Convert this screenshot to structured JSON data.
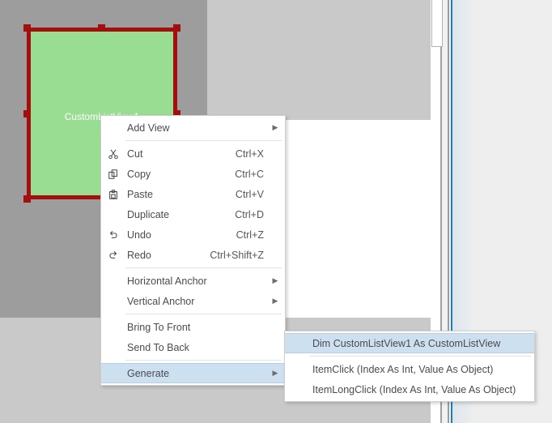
{
  "canvas": {
    "selected_view": {
      "label": "CustomListView1",
      "fill_color": "#99dd92",
      "border_color": "#a50e0e",
      "handle_color": "#a50e0e"
    },
    "backdrop_dark": "#9d9d9d",
    "backdrop_light": "#c9c9c9"
  },
  "context_menu": {
    "highlight_color": "#cde0f0",
    "items": [
      {
        "label": "Add View",
        "icon": "",
        "shortcut": "",
        "arrow": true,
        "selected": false,
        "separator_after": true
      },
      {
        "label": "Cut",
        "icon": "cut-icon",
        "shortcut": "Ctrl+X",
        "arrow": false,
        "selected": false,
        "separator_after": false
      },
      {
        "label": "Copy",
        "icon": "copy-icon",
        "shortcut": "Ctrl+C",
        "arrow": false,
        "selected": false,
        "separator_after": false
      },
      {
        "label": "Paste",
        "icon": "paste-icon",
        "shortcut": "Ctrl+V",
        "arrow": false,
        "selected": false,
        "separator_after": false
      },
      {
        "label": "Duplicate",
        "icon": "",
        "shortcut": "Ctrl+D",
        "arrow": false,
        "selected": false,
        "separator_after": false
      },
      {
        "label": "Undo",
        "icon": "undo-icon",
        "shortcut": "Ctrl+Z",
        "arrow": false,
        "selected": false,
        "separator_after": false
      },
      {
        "label": "Redo",
        "icon": "redo-icon",
        "shortcut": "Ctrl+Shift+Z",
        "arrow": false,
        "selected": false,
        "separator_after": true
      },
      {
        "label": "Horizontal Anchor",
        "icon": "",
        "shortcut": "",
        "arrow": true,
        "selected": false,
        "separator_after": false
      },
      {
        "label": "Vertical Anchor",
        "icon": "",
        "shortcut": "",
        "arrow": true,
        "selected": false,
        "separator_after": true
      },
      {
        "label": "Bring To Front",
        "icon": "",
        "shortcut": "",
        "arrow": false,
        "selected": false,
        "separator_after": false
      },
      {
        "label": "Send To Back",
        "icon": "",
        "shortcut": "",
        "arrow": false,
        "selected": false,
        "separator_after": true
      },
      {
        "label": "Generate",
        "icon": "",
        "shortcut": "",
        "arrow": true,
        "selected": true,
        "separator_after": false
      }
    ]
  },
  "generate_submenu": {
    "items": [
      {
        "label": "Dim CustomListView1 As CustomListView",
        "selected": true,
        "separator_after": true
      },
      {
        "label": "ItemClick (Index As Int, Value As Object)",
        "selected": false,
        "separator_after": false
      },
      {
        "label": "ItemLongClick (Index As Int, Value As Object)",
        "selected": false,
        "separator_after": false
      }
    ]
  }
}
